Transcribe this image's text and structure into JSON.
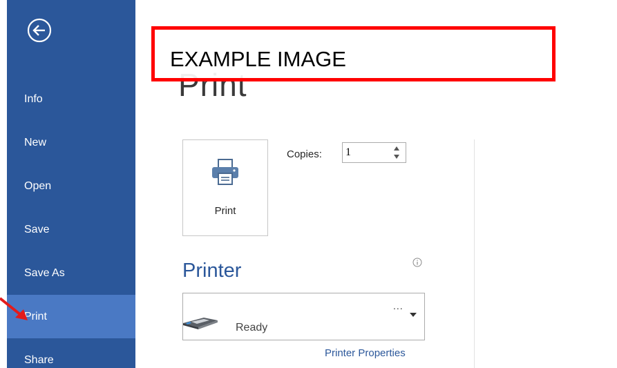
{
  "sidebar": {
    "items": [
      {
        "label": "Info"
      },
      {
        "label": "New"
      },
      {
        "label": "Open"
      },
      {
        "label": "Save"
      },
      {
        "label": "Save As"
      },
      {
        "label": "Print",
        "active": true
      },
      {
        "label": "Share"
      }
    ],
    "back_icon": "back-arrow-circle-icon"
  },
  "main": {
    "title": "Print",
    "banner": "EXAMPLE IMAGE",
    "print_button_label": "Print",
    "copies_label": "Copies:",
    "copies_value": "1",
    "printer_section_title": "Printer",
    "printer_status": "Ready",
    "printer_menu_ellipsis": "...",
    "printer_properties_link": "Printer Properties"
  },
  "colors": {
    "sidebar_bg": "#2b579a",
    "sidebar_active": "#4a79c4",
    "accent": "#2b579a",
    "banner_border": "#ff0000",
    "callout_arrow": "#e31b1b"
  },
  "icons": {
    "print": "printer-icon",
    "info": "info-icon",
    "device": "printer-device-icon",
    "spin_up": "spin-up-icon",
    "spin_down": "spin-down-icon",
    "dropdown": "chevron-down-icon",
    "callout": "red-arrow-icon"
  }
}
